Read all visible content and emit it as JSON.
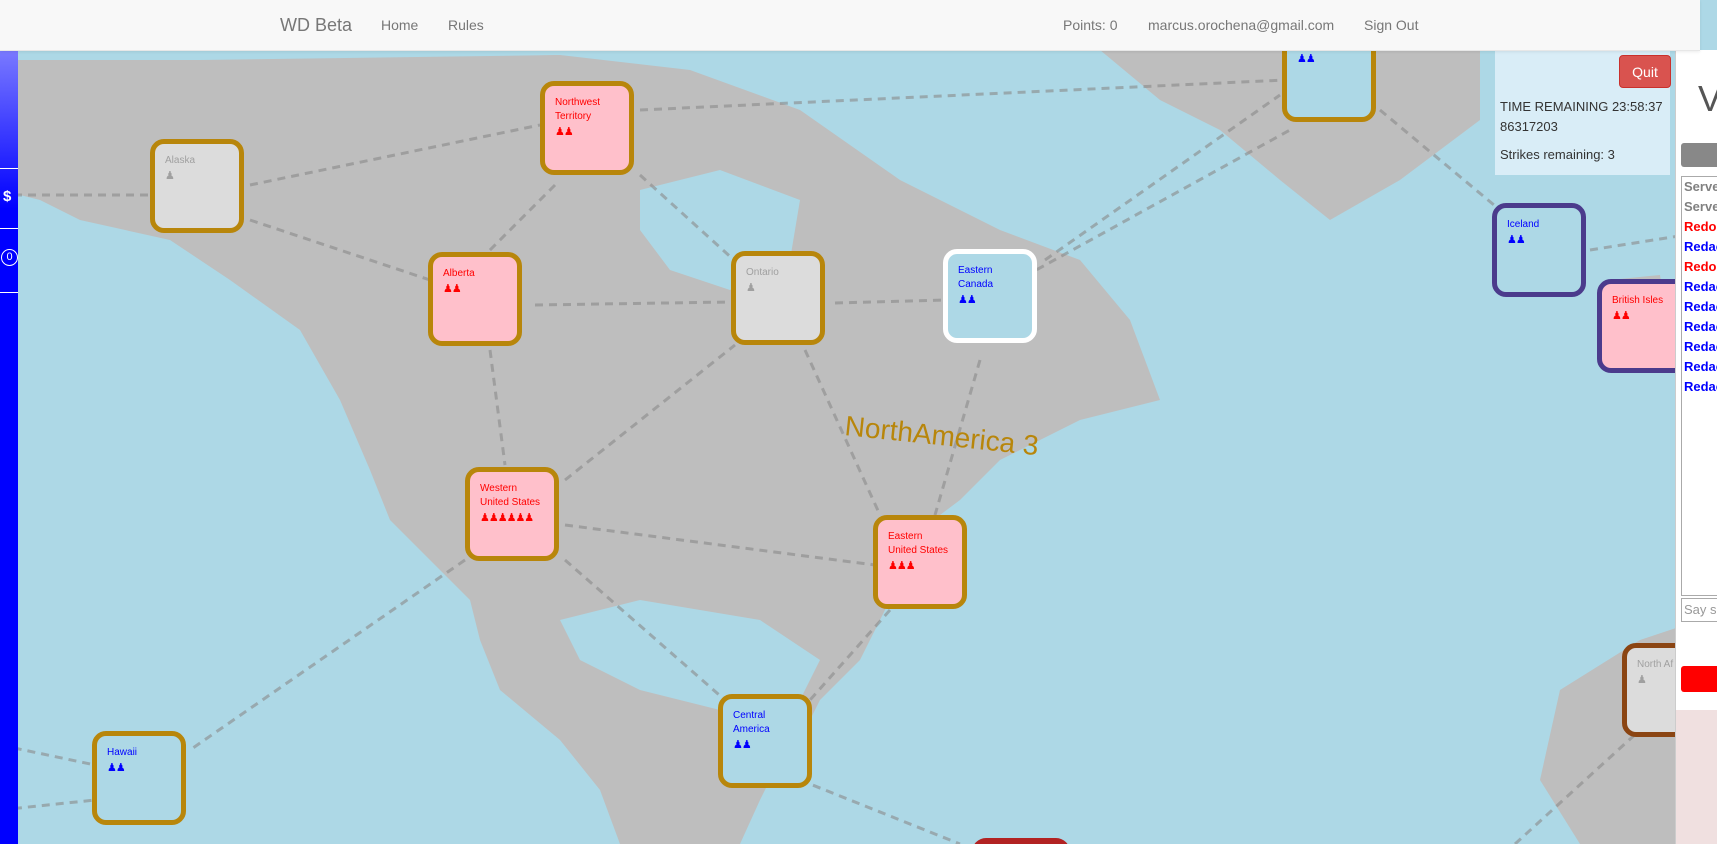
{
  "navbar": {
    "brand": "WD Beta",
    "home": "Home",
    "rules": "Rules",
    "points": "Points: 0",
    "email": "marcus.orochena@gmail.com",
    "sign_out": "Sign Out"
  },
  "sidebar": {
    "dollar": "$",
    "zero": "0"
  },
  "game": {
    "quit_label": "Quit",
    "time_remaining": "TIME REMAINING 23:58:37 86317203",
    "strikes": "Strikes remaining: 3"
  },
  "region_label": "NorthAmerica 3",
  "territories": {
    "alaska": {
      "name": "Alaska",
      "units": "♟"
    },
    "northwest_territory": {
      "name": "Northwest Territory",
      "units": "♟♟"
    },
    "alberta": {
      "name": "Alberta",
      "units": "♟♟"
    },
    "ontario": {
      "name": "Ontario",
      "units": "♟"
    },
    "eastern_canada": {
      "name": "Eastern Canada",
      "units": "♟♟"
    },
    "western_united_states": {
      "name": "Western United States",
      "units": "♟♟♟♟♟♟"
    },
    "eastern_united_states": {
      "name": "Eastern United States",
      "units": "♟♟♟"
    },
    "central_america": {
      "name": "Central America",
      "units": "♟♟"
    },
    "hawaii": {
      "name": "Hawaii",
      "units": "♟♟"
    },
    "iceland": {
      "name": "Iceland",
      "units": "♟♟"
    },
    "british_isles": {
      "name": "British Isles",
      "units": "♟♟"
    },
    "north_africa": {
      "name": "North Af",
      "units": "♟"
    },
    "greenland": {
      "name": "",
      "units": "♟♟"
    }
  },
  "chat": {
    "messages": [
      {
        "text": "Server",
        "color": "#808080"
      },
      {
        "text": "Server",
        "color": "#808080"
      },
      {
        "text": "Redo",
        "color": "#ff0000"
      },
      {
        "text": "Redac",
        "color": "#0000ff"
      },
      {
        "text": "Redo",
        "color": "#ff0000"
      },
      {
        "text": "Redac",
        "color": "#0000ff"
      },
      {
        "text": "Redac",
        "color": "#0000ff"
      },
      {
        "text": "Redac",
        "color": "#0000ff"
      },
      {
        "text": "Redac",
        "color": "#0000ff"
      },
      {
        "text": "Redac",
        "color": "#0000ff"
      },
      {
        "text": "Redac",
        "color": "#0000ff"
      }
    ],
    "placeholder": "Say s",
    "heading_initial": "V"
  },
  "colors": {
    "ocean": "#ADD8E6",
    "land": "#BEBEBE",
    "pink_owner": "#FFC0CB",
    "neutral": "#DCDCDC",
    "region_border": "#B8860B",
    "europe_border": "#4B3B8C",
    "africa_border": "#8B4513",
    "sidebar_blue": "#0000FF"
  }
}
